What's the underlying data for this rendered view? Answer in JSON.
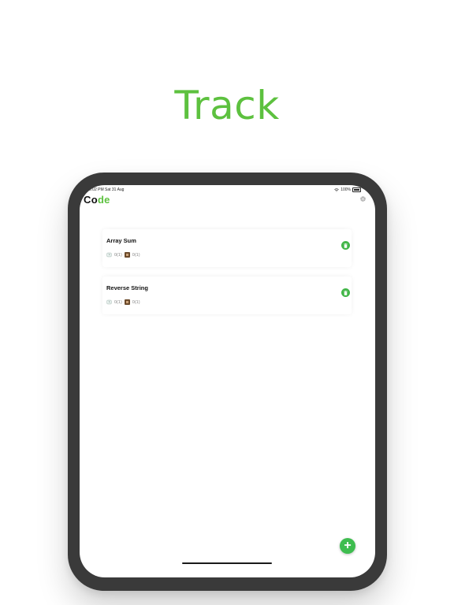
{
  "headline": "Track",
  "status_bar": {
    "time": "5:02 PM",
    "date": "Sat 31 Aug",
    "battery": "100%"
  },
  "app": {
    "title_part1": "Co",
    "title_part2": "de",
    "settings_icon": "gear-icon",
    "accent_color": "#5dc13f"
  },
  "tasks": [
    {
      "name": "Array Sum",
      "time_complexity": "0(1)",
      "space_complexity": "0(1)"
    },
    {
      "name": "Reverse String",
      "time_complexity": "0(1)",
      "space_complexity": "0(1)"
    }
  ],
  "actions": {
    "add_icon": "plus-icon",
    "add_label": "+"
  }
}
